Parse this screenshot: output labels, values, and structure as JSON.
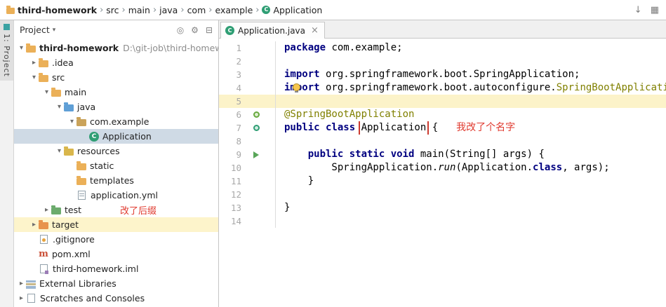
{
  "breadcrumb": {
    "items": [
      {
        "label": "third-homework",
        "icon": "folder",
        "bold": true
      },
      {
        "label": "src"
      },
      {
        "label": "main"
      },
      {
        "label": "java"
      },
      {
        "label": "com"
      },
      {
        "label": "example"
      },
      {
        "label": "Application",
        "icon": "class"
      }
    ]
  },
  "nav_actions": [
    "scroll-down",
    "grid"
  ],
  "toolwindow_bar": {
    "project_tab": "1: Project"
  },
  "project_panel": {
    "header": {
      "title": "Project",
      "icons": [
        "locate",
        "settings",
        "collapse"
      ]
    },
    "tree": [
      {
        "label": "third-homework",
        "suffix": "D:\\git-job\\third-homewor",
        "level": 0,
        "chevron": "expanded",
        "icon": "folder",
        "bold": true
      },
      {
        "label": ".idea",
        "level": 1,
        "chevron": "collapsed",
        "icon": "folder"
      },
      {
        "label": "src",
        "level": 1,
        "chevron": "expanded",
        "icon": "folder"
      },
      {
        "label": "main",
        "level": 2,
        "chevron": "expanded",
        "icon": "folder"
      },
      {
        "label": "java",
        "level": 3,
        "chevron": "expanded",
        "icon": "folder-blue"
      },
      {
        "label": "com.example",
        "level": 4,
        "chevron": "expanded",
        "icon": "package"
      },
      {
        "label": "Application",
        "level": 5,
        "chevron": "none",
        "icon": "class",
        "selected": true
      },
      {
        "label": "resources",
        "level": 3,
        "chevron": "expanded",
        "icon": "folder-res"
      },
      {
        "label": "static",
        "level": 4,
        "chevron": "none",
        "icon": "folder"
      },
      {
        "label": "templates",
        "level": 4,
        "chevron": "none",
        "icon": "folder"
      },
      {
        "label": "application.yml",
        "level": 4,
        "chevron": "none",
        "icon": "file-yml"
      },
      {
        "label": "test",
        "level": 2,
        "chevron": "collapsed",
        "icon": "folder-test",
        "note": "改了后缀"
      },
      {
        "label": "target",
        "level": 1,
        "chevron": "collapsed",
        "icon": "folder-excluded",
        "highlight": true
      },
      {
        "label": ".gitignore",
        "level": 1,
        "chevron": "none",
        "icon": "file-git"
      },
      {
        "label": "pom.xml",
        "level": 1,
        "chevron": "none",
        "icon": "maven"
      },
      {
        "label": "third-homework.iml",
        "level": 1,
        "chevron": "none",
        "icon": "file-iml"
      },
      {
        "label": "External Libraries",
        "level": 0,
        "chevron": "collapsed",
        "icon": "libraries"
      },
      {
        "label": "Scratches and Consoles",
        "level": 0,
        "chevron": "collapsed",
        "icon": "scratches"
      }
    ]
  },
  "editor": {
    "tab": {
      "label": "Application.java"
    },
    "lines": [
      {
        "num": 1,
        "tokens": [
          {
            "t": "package",
            "c": "kw"
          },
          {
            "t": " com.example;",
            "c": "pl"
          }
        ]
      },
      {
        "num": 2,
        "tokens": []
      },
      {
        "num": 3,
        "tokens": [
          {
            "t": "import",
            "c": "kw"
          },
          {
            "t": " org.springframework.boot.SpringApplication;",
            "c": "pl"
          }
        ]
      },
      {
        "num": 4,
        "bulb": true,
        "tokens": [
          {
            "t": "import",
            "c": "kw"
          },
          {
            "t": " org.springframework.boot.autoconfigure.",
            "c": "pl"
          },
          {
            "t": "SpringBootApplication",
            "c": "ann"
          },
          {
            "t": ";",
            "c": "pl"
          }
        ]
      },
      {
        "num": 5,
        "caret_line": true,
        "tokens": []
      },
      {
        "num": 6,
        "gutter": "bean",
        "tokens": [
          {
            "t": "@SpringBootApplication",
            "c": "ann"
          }
        ]
      },
      {
        "num": 7,
        "gutter": "bean2",
        "note": "我改了个名字",
        "tokens": [
          {
            "t": "public class ",
            "c": "kw"
          },
          {
            "t": "Application",
            "c": "pl",
            "boxed": true
          },
          {
            "t": " {",
            "c": "pl"
          }
        ]
      },
      {
        "num": 8,
        "tokens": []
      },
      {
        "num": 9,
        "gutter": "run",
        "tokens": [
          {
            "t": "    ",
            "c": "pl"
          },
          {
            "t": "public static void ",
            "c": "kw"
          },
          {
            "t": "main(String[] args) {",
            "c": "pl"
          }
        ]
      },
      {
        "num": 10,
        "tokens": [
          {
            "t": "        SpringApplication.",
            "c": "pl"
          },
          {
            "t": "run",
            "c": "it"
          },
          {
            "t": "(Application.",
            "c": "pl"
          },
          {
            "t": "class",
            "c": "kw"
          },
          {
            "t": ", args);",
            "c": "pl"
          }
        ]
      },
      {
        "num": 11,
        "tokens": [
          {
            "t": "    }",
            "c": "pl"
          }
        ]
      },
      {
        "num": 12,
        "tokens": []
      },
      {
        "num": 13,
        "tokens": [
          {
            "t": "}",
            "c": "pl"
          }
        ]
      },
      {
        "num": 14,
        "tokens": []
      }
    ]
  },
  "colors": {
    "keyword": "#000080",
    "annotation": "#808000",
    "red_annotation": "#e03a2f",
    "caret_line": "#fcf3c9",
    "selected_row": "#cfdae5",
    "highlighted_row": "#fdf4cb",
    "highlight_box": "#cc3b30"
  }
}
